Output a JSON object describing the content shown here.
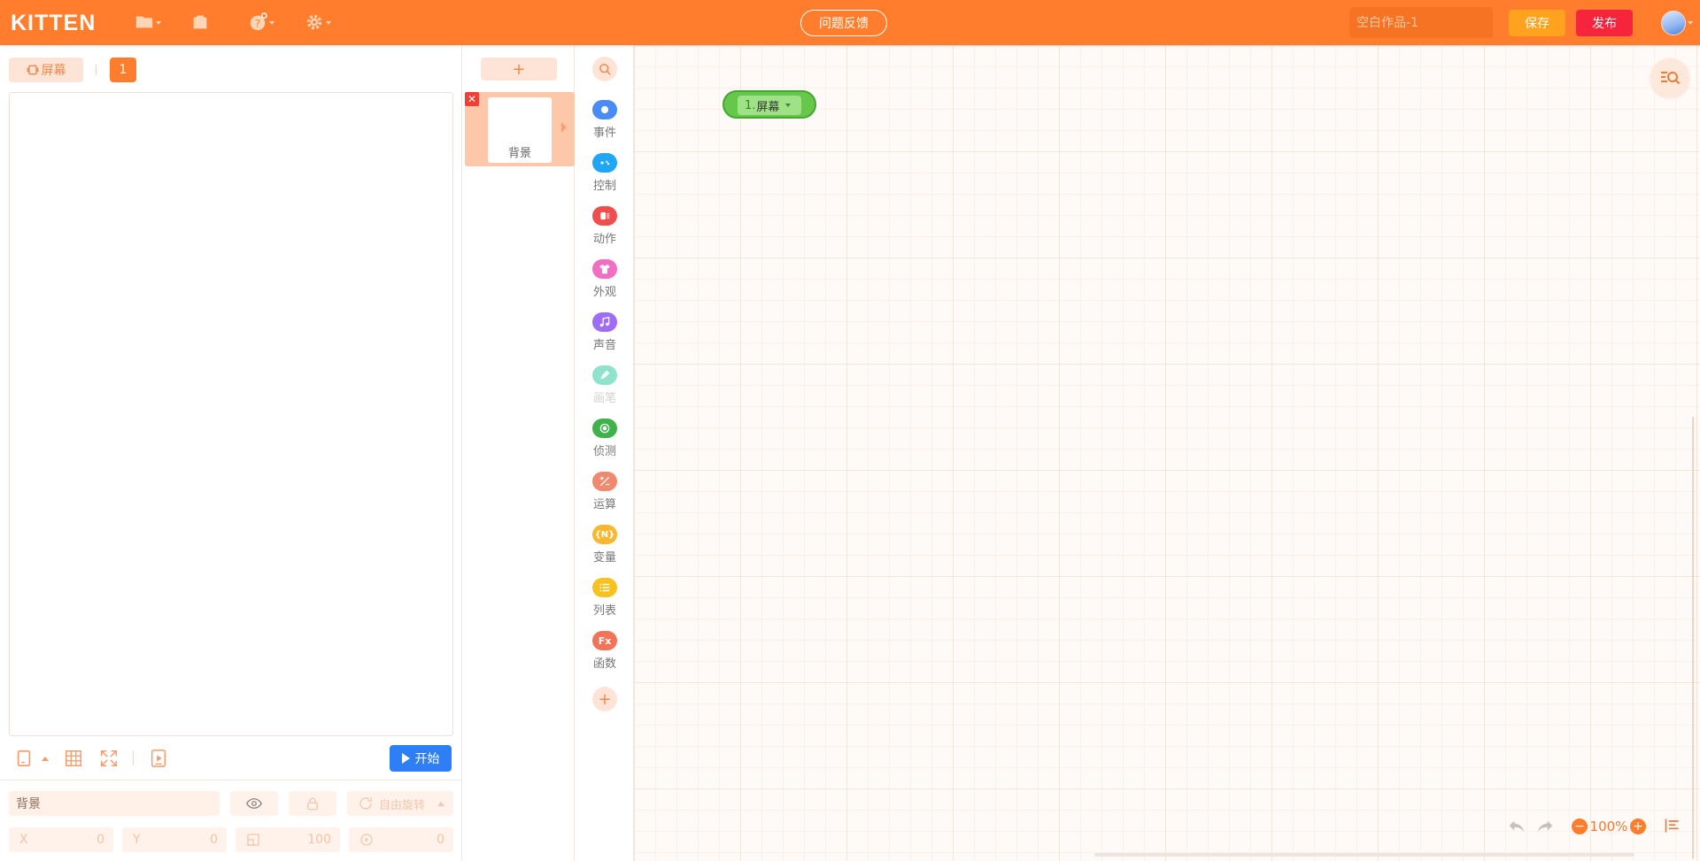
{
  "header": {
    "logo": "KITTEN",
    "feedback_label": "问题反馈",
    "title_placeholder": "空白作品-1",
    "save_label": "保存",
    "publish_label": "发布",
    "icons": [
      "folder-icon",
      "backpack-icon",
      "help-icon",
      "gear-icon"
    ]
  },
  "stage": {
    "screen_tab_label": "屏幕",
    "screen_number": "1",
    "start_label": "开始",
    "tools": [
      "device-icon",
      "grid-icon",
      "fullscreen-icon",
      "preview-play-icon"
    ]
  },
  "properties": {
    "name_value": "背景",
    "rotation_label": "自由旋转",
    "x_label": "X",
    "x_value": "0",
    "y_label": "Y",
    "y_value": "0",
    "size_value": "100",
    "direction_value": "0"
  },
  "sprites": {
    "add_label": "+",
    "items": [
      {
        "label": "背景"
      }
    ]
  },
  "categories": {
    "items": [
      {
        "label": "事件",
        "color": "#4a8cf7"
      },
      {
        "label": "控制",
        "color": "#1fa6f4"
      },
      {
        "label": "动作",
        "color": "#f04e4e"
      },
      {
        "label": "外观",
        "color": "#f16fc2"
      },
      {
        "label": "声音",
        "color": "#9f6cf5"
      },
      {
        "label": "画笔",
        "color": "#8fe3cd"
      },
      {
        "label": "侦测",
        "color": "#3fb24a"
      },
      {
        "label": "运算",
        "color": "#f08a6e"
      },
      {
        "label": "变量",
        "color": "#f9b731"
      },
      {
        "label": "列表",
        "color": "#f7c21d"
      },
      {
        "label": "函数",
        "color": "#f2725a"
      }
    ],
    "add_label": "+"
  },
  "workspace": {
    "event_block": {
      "number": "1.",
      "screen_label": "屏幕"
    },
    "zoom": "100%"
  }
}
